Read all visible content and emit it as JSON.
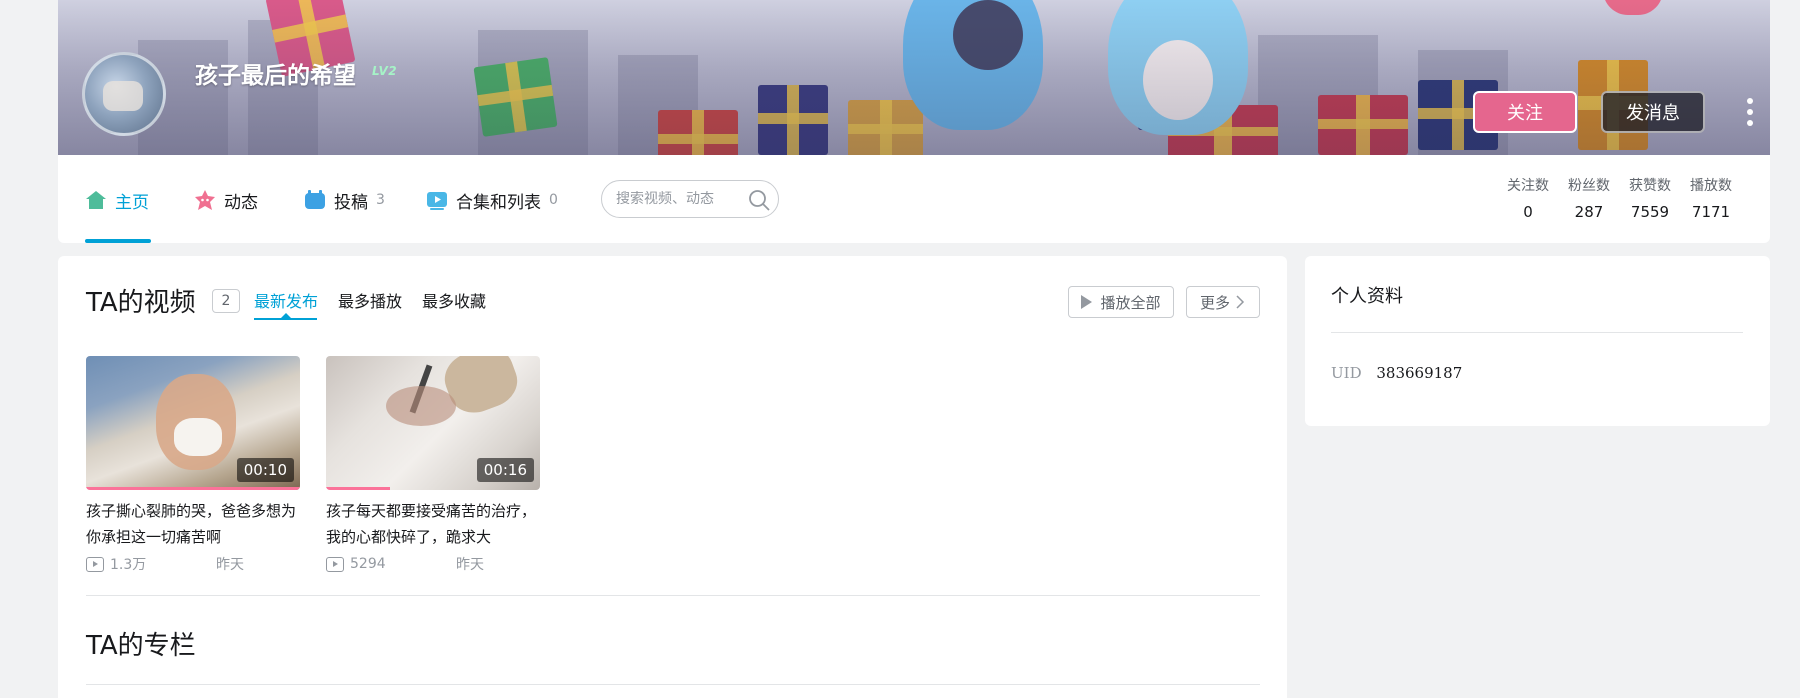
{
  "header": {
    "username": "孩子最后的希望",
    "level": "LV2",
    "follow_label": "关注",
    "message_label": "发消息",
    "colors": {
      "follow": "#e5668e",
      "accent": "#00a1d6",
      "level": "#a6f3c7"
    }
  },
  "nav": {
    "tabs": [
      {
        "label": "主页",
        "icon": "home-icon",
        "active": true
      },
      {
        "label": "动态",
        "icon": "dynamic-icon"
      },
      {
        "label": "投稿",
        "count": "3",
        "icon": "upload-icon"
      },
      {
        "label": "合集和列表",
        "count": "0",
        "icon": "collection-icon"
      }
    ],
    "search_placeholder": "搜索视频、动态",
    "stats": [
      {
        "label": "关注数",
        "value": "0"
      },
      {
        "label": "粉丝数",
        "value": "287"
      },
      {
        "label": "获赞数",
        "value": "7559"
      },
      {
        "label": "播放数",
        "value": "7171"
      }
    ]
  },
  "videos_section": {
    "title": "TA的视频",
    "count": "2",
    "sorts": [
      "最新发布",
      "最多播放",
      "最多收藏"
    ],
    "play_all_label": "播放全部",
    "more_label": "更多",
    "items": [
      {
        "title": "孩子撕心裂肺的哭，爸爸多想为你承担这一切痛苦啊",
        "duration": "00:10",
        "plays": "1.3万",
        "date": "昨天"
      },
      {
        "title": "孩子每天都要接受痛苦的治疗，我的心都快碎了，跪求大",
        "duration": "00:16",
        "plays": "5294",
        "date": "昨天"
      }
    ]
  },
  "column_section": {
    "title": "TA的专栏"
  },
  "profile": {
    "title": "个人资料",
    "uid_label": "UID",
    "uid_value": "383669187"
  }
}
